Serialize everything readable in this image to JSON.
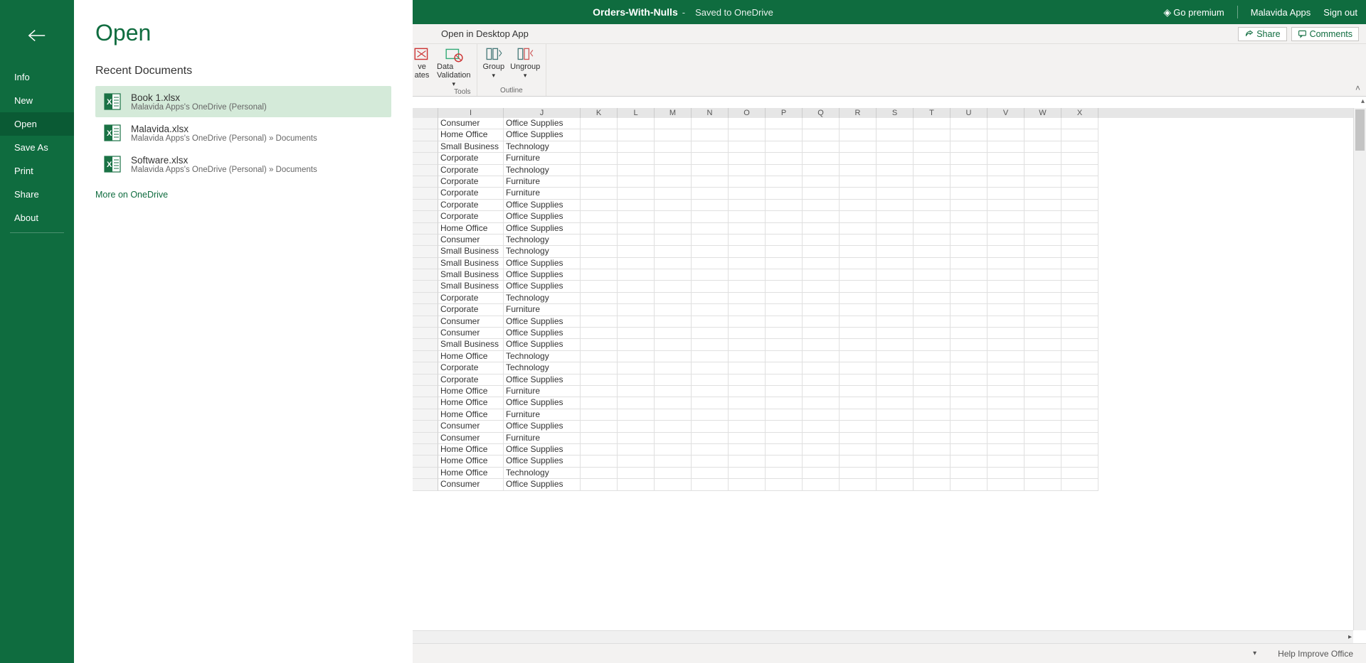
{
  "titlebar": {
    "doc_name": "Orders-With-Nulls",
    "save_status": "Saved to OneDrive",
    "go_premium": "Go premium",
    "account": "Malavida Apps",
    "sign_out": "Sign out"
  },
  "tabrow": {
    "open_desktop": "Open in Desktop App",
    "share": "Share",
    "comments": "Comments"
  },
  "ribbon": {
    "data_validation": "Data\nValidation",
    "group": "Group",
    "ungroup": "Ungroup",
    "group_data_tools": "Data Tools",
    "group_outline": "Outline",
    "partial_ve": "ve",
    "partial_ates": "ates",
    "partial_tools": "Tools"
  },
  "backstage": {
    "title": "Open",
    "section": "Recent Documents",
    "nav": {
      "info": "Info",
      "new": "New",
      "open": "Open",
      "save_as": "Save As",
      "print": "Print",
      "share": "Share",
      "about": "About"
    },
    "docs": [
      {
        "name": "Book 1.xlsx",
        "path": "Malavida Apps's OneDrive (Personal)"
      },
      {
        "name": "Malavida.xlsx",
        "path": "Malavida Apps's OneDrive (Personal) » Documents"
      },
      {
        "name": "Software.xlsx",
        "path": "Malavida Apps's OneDrive (Personal) » Documents"
      }
    ],
    "more": "More on OneDrive"
  },
  "grid": {
    "columns": [
      "I",
      "J",
      "K",
      "L",
      "M",
      "N",
      "O",
      "P",
      "Q",
      "R",
      "S",
      "T",
      "U",
      "V",
      "W",
      "X"
    ],
    "rows": [
      {
        "I": "Consumer",
        "J": "Office Supplies"
      },
      {
        "I": "Home Office",
        "J": "Office Supplies"
      },
      {
        "I": "Small Business",
        "J": "Technology"
      },
      {
        "I": "Corporate",
        "J": "Furniture"
      },
      {
        "I": "Corporate",
        "J": "Technology"
      },
      {
        "I": "Corporate",
        "J": "Furniture"
      },
      {
        "I": "Corporate",
        "J": "Furniture"
      },
      {
        "I": "Corporate",
        "J": "Office Supplies"
      },
      {
        "I": "Corporate",
        "J": "Office Supplies"
      },
      {
        "I": "Home Office",
        "J": "Office Supplies"
      },
      {
        "I": "Consumer",
        "J": "Technology"
      },
      {
        "I": "Small Business",
        "J": "Technology"
      },
      {
        "I": "Small Business",
        "J": "Office Supplies"
      },
      {
        "I": "Small Business",
        "J": "Office Supplies"
      },
      {
        "I": "Small Business",
        "J": "Office Supplies"
      },
      {
        "I": "Corporate",
        "J": "Technology"
      },
      {
        "I": "Corporate",
        "J": "Furniture"
      },
      {
        "I": "Consumer",
        "J": "Office Supplies"
      },
      {
        "I": "Consumer",
        "J": "Office Supplies"
      },
      {
        "I": "Small Business",
        "J": "Office Supplies"
      },
      {
        "I": "Home Office",
        "J": "Technology"
      },
      {
        "I": "Corporate",
        "J": "Technology"
      },
      {
        "I": "Corporate",
        "J": "Office Supplies"
      },
      {
        "I": "Home Office",
        "J": "Furniture"
      },
      {
        "I": "Home Office",
        "J": "Office Supplies"
      },
      {
        "I": "Home Office",
        "J": "Furniture"
      },
      {
        "I": "Consumer",
        "J": "Office Supplies"
      },
      {
        "I": "Consumer",
        "J": "Furniture"
      },
      {
        "I": "Home Office",
        "J": "Office Supplies"
      },
      {
        "I": "Home Office",
        "J": "Office Supplies"
      },
      {
        "I": "Home Office",
        "J": "Technology"
      },
      {
        "I": "Consumer",
        "J": "Office Supplies"
      }
    ]
  },
  "statusbar": {
    "help": "Help Improve Office"
  }
}
